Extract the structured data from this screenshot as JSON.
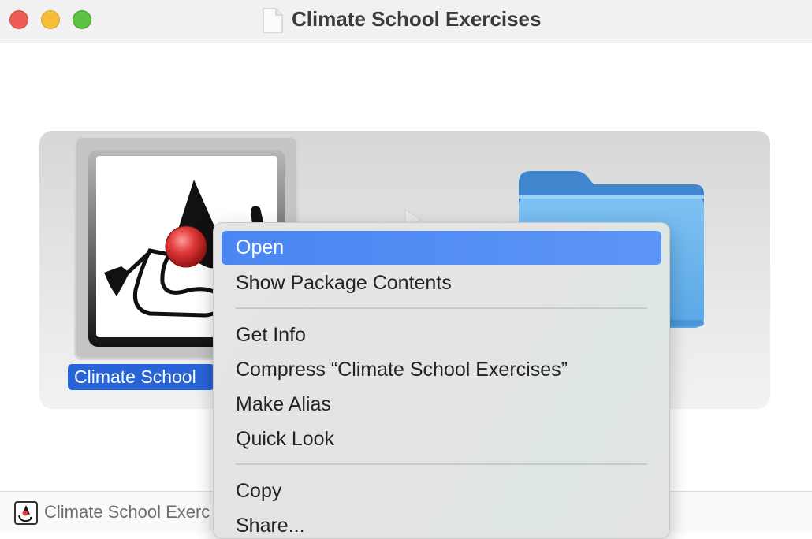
{
  "window": {
    "title": "Climate School Exercises"
  },
  "content": {
    "app_label": "Climate School"
  },
  "statusbar": {
    "path_text": "Climate School Exerc"
  },
  "context_menu": {
    "items": [
      {
        "label": "Open",
        "selected": true
      },
      {
        "label": "Show Package Contents"
      },
      {
        "label": "Get Info"
      },
      {
        "label": "Compress “Climate School Exercises”"
      },
      {
        "label": "Make Alias"
      },
      {
        "label": "Quick Look"
      },
      {
        "label": "Copy"
      },
      {
        "label": "Share..."
      }
    ]
  },
  "colors": {
    "selection_blue": "#2864d6",
    "menu_highlight": "#4b86f2",
    "folder_blue": "#6fb6ee"
  },
  "icons": [
    "document-icon",
    "java-duke-app-icon",
    "arrow-icon",
    "folder-icon"
  ]
}
